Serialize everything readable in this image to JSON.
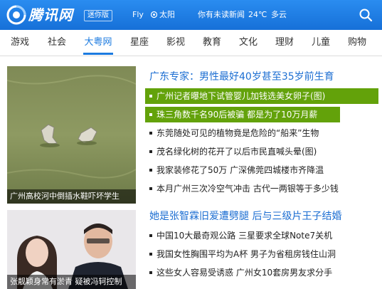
{
  "header": {
    "brand": "腾讯网",
    "badge": "迷你版",
    "weather_user": "Fly",
    "weather_label": "太阳",
    "news_msg": "你有未读新闻",
    "temperature": "24℃",
    "condition": "多云"
  },
  "nav": {
    "items": [
      "游戏",
      "社会",
      "大粤网",
      "星座",
      "影视",
      "教育",
      "文化",
      "理财",
      "儿童",
      "购物"
    ],
    "active": "大粤网"
  },
  "section1": {
    "image_caption": "广州高校河中倒插水鞋吓坏学生",
    "headline": "广东专家：男性最好40岁甚至35岁前生育",
    "items": [
      "广州记者曝地下试管婴儿加钱选美女卵子(图)",
      "珠三角数千名90后被骗 都是为了10万月薪",
      "东莞随处可见的植物竟是危险的“船来”生物",
      "茂名绿化树的花开了以后市民直喊头晕(图)",
      "我家装修花了50万 广深佛莞四城楼市齐降温",
      "本月广州三次冷空气冲击 古代一两银等于多少钱"
    ]
  },
  "section2": {
    "image_caption": "张靓颖身常有淤青 疑被冯轲控制",
    "headline": "她是张智霖旧爱遭劈腿 后与三级片王子结婚",
    "items": [
      "中国10大最奇观公路 三星要求全球Note7关机",
      "我国女性胸围平均为A杯 男子为省租房钱住山洞",
      "这些女人容易受诱惑 广州女10套房男友求分手"
    ]
  },
  "colors": {
    "brand_blue": "#1c7be0",
    "headline_blue": "#1c6ed2",
    "highlight_green": "#63a20a"
  }
}
